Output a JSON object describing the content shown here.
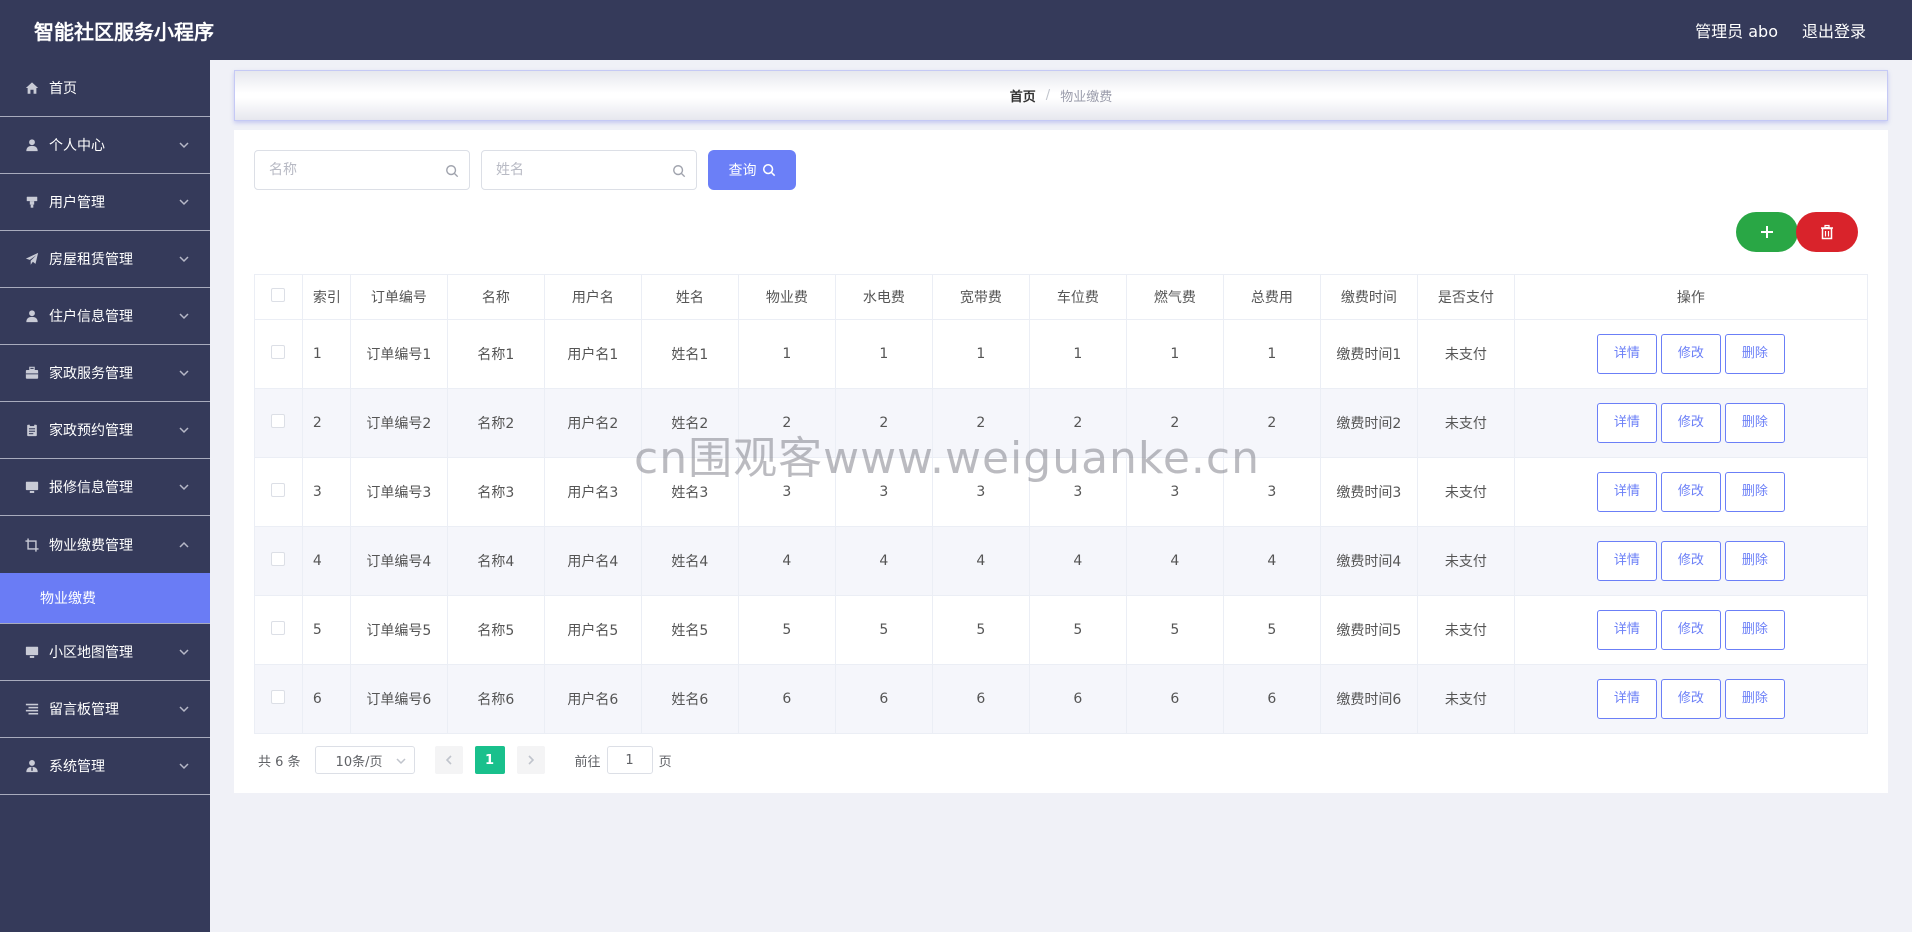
{
  "header": {
    "app_title": "智能社区服务小程序",
    "user_label": "管理员 abo",
    "logout_label": "退出登录"
  },
  "sidebar": {
    "items": [
      {
        "label": "首页",
        "icon": "home-icon",
        "has_arrow": false
      },
      {
        "label": "个人中心",
        "icon": "user-icon",
        "has_arrow": true
      },
      {
        "label": "用户管理",
        "icon": "stamp-icon",
        "has_arrow": true
      },
      {
        "label": "房屋租赁管理",
        "icon": "paper-plane-icon",
        "has_arrow": true
      },
      {
        "label": "住户信息管理",
        "icon": "user-icon",
        "has_arrow": true
      },
      {
        "label": "家政服务管理",
        "icon": "briefcase-icon",
        "has_arrow": true
      },
      {
        "label": "家政预约管理",
        "icon": "clipboard-icon",
        "has_arrow": true
      },
      {
        "label": "报修信息管理",
        "icon": "monitor-icon",
        "has_arrow": true
      },
      {
        "label": "物业缴费管理",
        "icon": "crop-icon",
        "has_arrow": true,
        "expanded": true
      },
      {
        "label": "小区地图管理",
        "icon": "monitor-icon",
        "has_arrow": true
      },
      {
        "label": "留言板管理",
        "icon": "list-icon",
        "has_arrow": true
      },
      {
        "label": "系统管理",
        "icon": "user-tie-icon",
        "has_arrow": true
      }
    ],
    "active_sub_item": "物业缴费"
  },
  "breadcrumb": {
    "home": "首页",
    "separator": "/",
    "current": "物业缴费"
  },
  "search": {
    "name_placeholder": "名称",
    "person_placeholder": "姓名",
    "query_label": "查询"
  },
  "table": {
    "headers": [
      "",
      "索引",
      "订单编号",
      "名称",
      "用户名",
      "姓名",
      "物业费",
      "水电费",
      "宽带费",
      "车位费",
      "燃气费",
      "总费用",
      "缴费时间",
      "是否支付",
      "操作"
    ],
    "rows": [
      {
        "index": "1",
        "order_no": "订单编号1",
        "name": "名称1",
        "username": "用户名1",
        "person": "姓名1",
        "property_fee": "1",
        "utility_fee": "1",
        "broadband_fee": "1",
        "parking_fee": "1",
        "gas_fee": "1",
        "total_fee": "1",
        "pay_time": "缴费时间1",
        "paid": "未支付"
      },
      {
        "index": "2",
        "order_no": "订单编号2",
        "name": "名称2",
        "username": "用户名2",
        "person": "姓名2",
        "property_fee": "2",
        "utility_fee": "2",
        "broadband_fee": "2",
        "parking_fee": "2",
        "gas_fee": "2",
        "total_fee": "2",
        "pay_time": "缴费时间2",
        "paid": "未支付"
      },
      {
        "index": "3",
        "order_no": "订单编号3",
        "name": "名称3",
        "username": "用户名3",
        "person": "姓名3",
        "property_fee": "3",
        "utility_fee": "3",
        "broadband_fee": "3",
        "parking_fee": "3",
        "gas_fee": "3",
        "total_fee": "3",
        "pay_time": "缴费时间3",
        "paid": "未支付"
      },
      {
        "index": "4",
        "order_no": "订单编号4",
        "name": "名称4",
        "username": "用户名4",
        "person": "姓名4",
        "property_fee": "4",
        "utility_fee": "4",
        "broadband_fee": "4",
        "parking_fee": "4",
        "gas_fee": "4",
        "total_fee": "4",
        "pay_time": "缴费时间4",
        "paid": "未支付"
      },
      {
        "index": "5",
        "order_no": "订单编号5",
        "name": "名称5",
        "username": "用户名5",
        "person": "姓名5",
        "property_fee": "5",
        "utility_fee": "5",
        "broadband_fee": "5",
        "parking_fee": "5",
        "gas_fee": "5",
        "total_fee": "5",
        "pay_time": "缴费时间5",
        "paid": "未支付"
      },
      {
        "index": "6",
        "order_no": "订单编号6",
        "name": "名称6",
        "username": "用户名6",
        "person": "姓名6",
        "property_fee": "6",
        "utility_fee": "6",
        "broadband_fee": "6",
        "parking_fee": "6",
        "gas_fee": "6",
        "total_fee": "6",
        "pay_time": "缴费时间6",
        "paid": "未支付"
      }
    ],
    "actions": {
      "detail": "详情",
      "edit": "修改",
      "delete": "删除"
    }
  },
  "pagination": {
    "total_label": "共 6 条",
    "page_size": "10条/页",
    "current_page": "1",
    "goto_label": "前往",
    "goto_value": "1",
    "page_suffix": "页"
  },
  "watermark": "cn围观客www.weiguanke.cn",
  "colors": {
    "header_bg": "#353a5a",
    "accent": "#6b7ff7",
    "add_button": "#29a745",
    "delete_button": "#d9232b",
    "pager_active": "#19c08c"
  }
}
